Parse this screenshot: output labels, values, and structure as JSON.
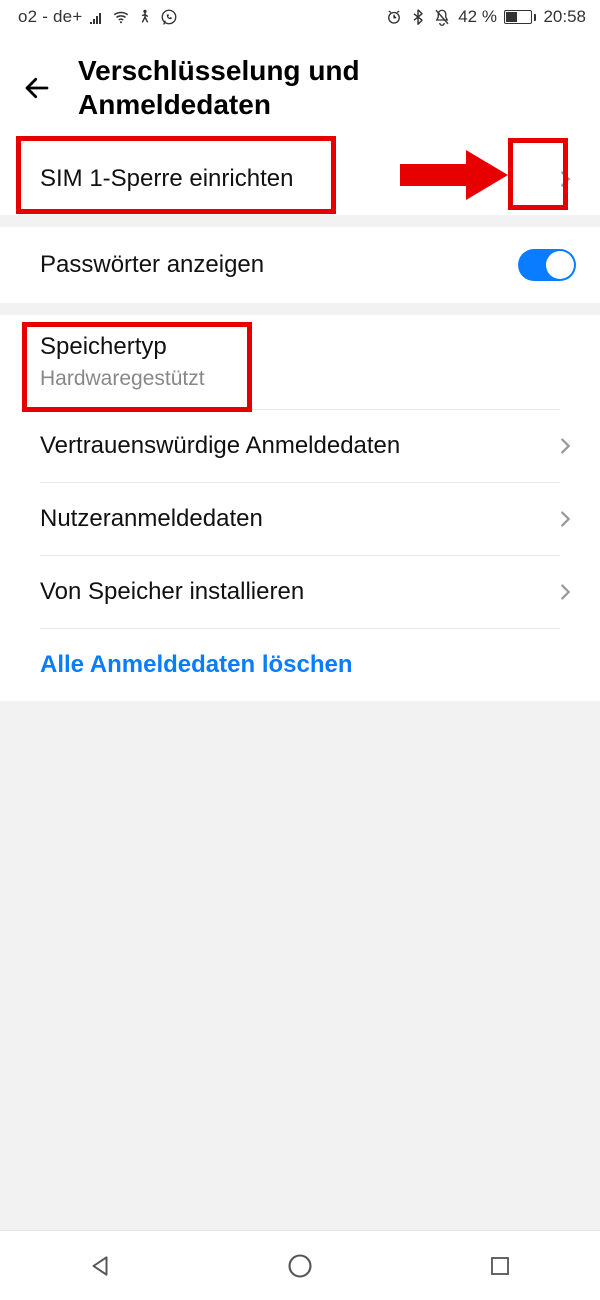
{
  "status": {
    "carrier": "o2 - de+",
    "battery_pct": "42 %",
    "time": "20:58"
  },
  "header": {
    "title_line1": "Verschlüsselung und",
    "title_line2": "Anmeldedaten"
  },
  "rows": {
    "sim_lock": "SIM 1-Sperre einrichten",
    "show_passwords": "Passwörter anzeigen",
    "storage_type_label": "Speichertyp",
    "storage_type_value": "Hardwaregestützt",
    "trusted_creds": "Vertrauenswürdige Anmeldedaten",
    "user_creds": "Nutzeranmeldedaten",
    "install_from_storage": "Von Speicher installieren",
    "clear_all": "Alle Anmeldedaten löschen"
  },
  "toggles": {
    "show_passwords_on": true
  },
  "colors": {
    "accent": "#0a7cff",
    "annotation": "#e60000"
  }
}
